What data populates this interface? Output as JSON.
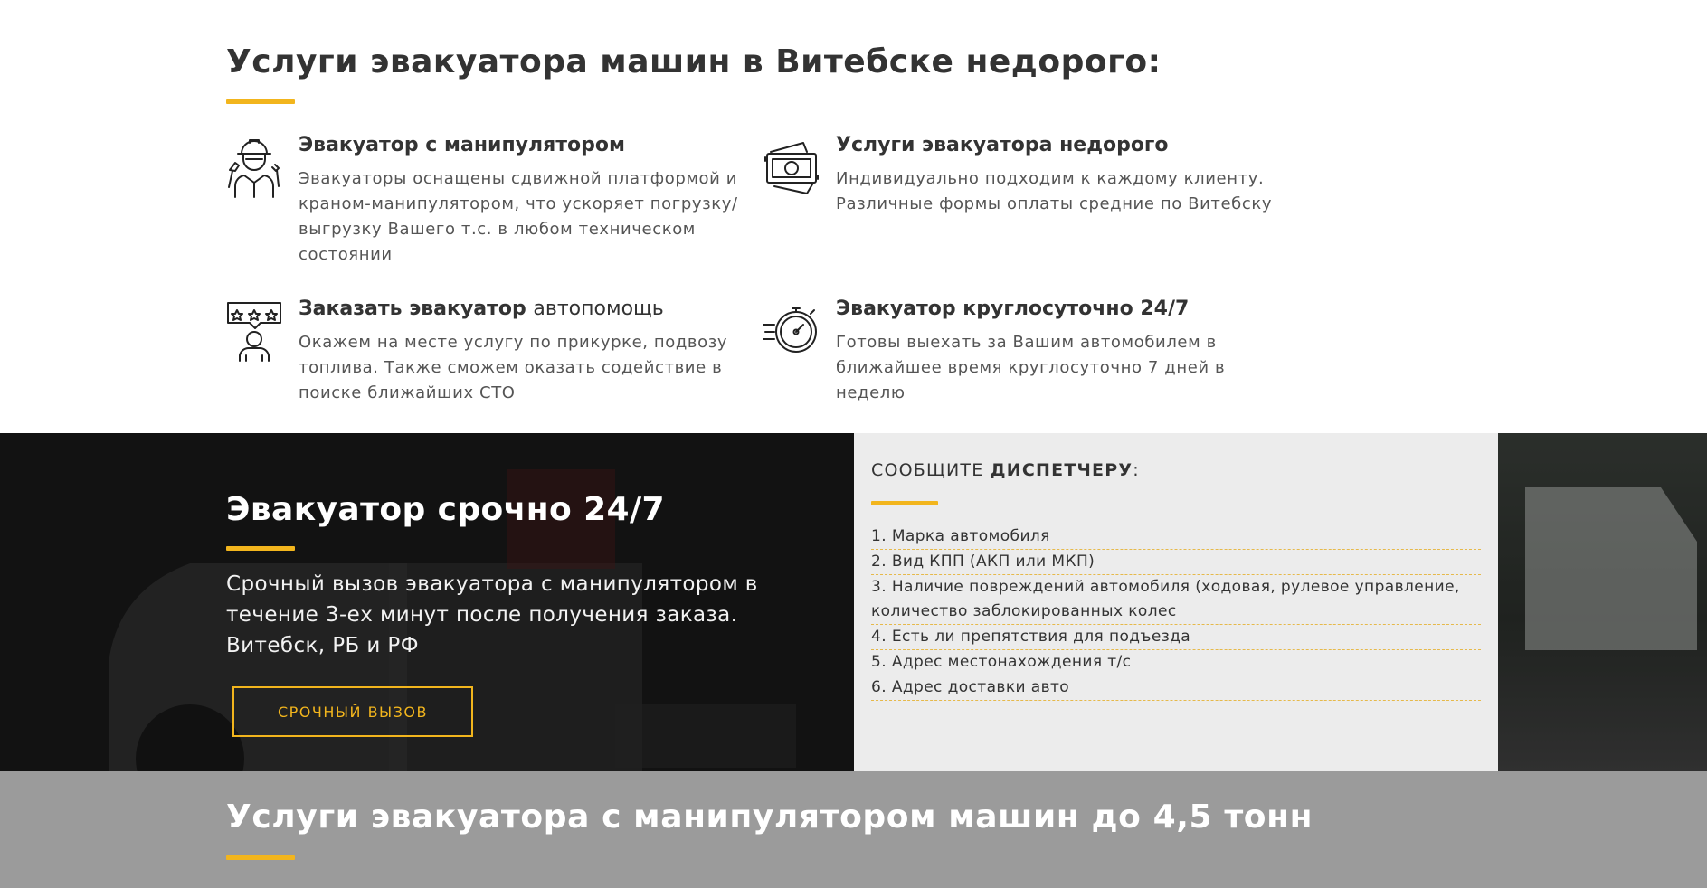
{
  "services": {
    "title": "Услуги эвакуатора машин в Витебске недорого:",
    "features": [
      {
        "icon": "mechanic-icon",
        "title": "Эвакуатор с манипулятором",
        "title_light": "",
        "text": "Эвакуаторы оснащены сдвижной платформой и краном-манипулятором, что ускоряет погрузку/выгрузку Вашего т.с. в любом техническом состоянии"
      },
      {
        "icon": "money-icon",
        "title": "Услуги эвакуатора недорого",
        "title_light": "",
        "text": "Индивидуально подходим к каждому клиенту. Различные формы оплаты средние по Витебску"
      },
      {
        "icon": "rating-person-icon",
        "title": "Заказать эвакуатор",
        "title_light": "автопомощь",
        "text": "Окажем на месте услугу по прикурке, подвозу топлива. Также сможем оказать содействие в поиске ближайших СТО"
      },
      {
        "icon": "stopwatch-icon",
        "title": "Эвакуатор круглосуточно 24/7",
        "title_light": "",
        "text": "Готовы выехать за Вашим автомобилем в ближайшее время круглосуточно 7 дней в неделю"
      }
    ]
  },
  "banner": {
    "title": "Эвакуатор срочно 24/7",
    "text": "Срочный вызов эвакуатора с манипулятором в течение 3-ех минут после получения заказа. Витебск, РБ и РФ",
    "cta_label": "СРОЧНЫЙ ВЫЗОВ"
  },
  "dispatch": {
    "title_prefix": "СООБЩИТЕ",
    "title_bold": "ДИСПЕТЧЕРУ",
    "title_suffix": ":",
    "items": [
      "1. Марка автомобиля",
      "2. Вид КПП (АКП или МКП)",
      "3. Наличие повреждений автомобиля (ходовая, рулевое управление, количество заблокированных колес",
      "4. Есть ли препятствия для подъезда",
      "5. Адрес местонахождения т/с",
      "6. Адрес доставки авто"
    ]
  },
  "bottom": {
    "title_regular": "Услуги эвакуатора с манипулятором машин",
    "title_bold": "до 4,5 тонн"
  },
  "colors": {
    "accent": "#f2b51d",
    "dark_bg": "#262626",
    "dispatch_bg": "#ececec",
    "bottom_bg": "#9b9b9b"
  }
}
